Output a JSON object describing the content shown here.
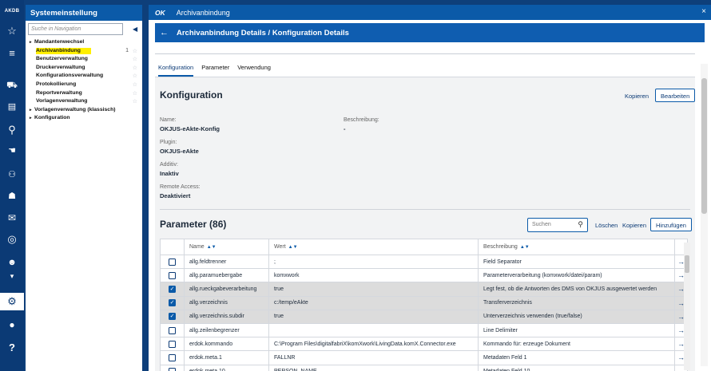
{
  "rail": {
    "logo": "AKDB",
    "icons": [
      "star-icon",
      "list-icon",
      "car-icon",
      "document-icon",
      "location-icon",
      "handshake-icon",
      "people-icon",
      "family-icon",
      "mail-icon",
      "target-icon",
      "user-gear-icon",
      "settings-icon",
      "user-icon",
      "help-icon"
    ]
  },
  "nav": {
    "title": "Systemeinstellung",
    "search_placeholder": "Suche in Navigation",
    "items": [
      {
        "label": "Mandantenwechsel",
        "arrow": "▸",
        "level": 0
      },
      {
        "label": "Archivanbindung",
        "level": 1,
        "highlight": true,
        "count": "1"
      },
      {
        "label": "Benutzerverwaltung",
        "level": 1
      },
      {
        "label": "Druckerverwaltung",
        "level": 1
      },
      {
        "label": "Konfigurationsverwaltung",
        "level": 1
      },
      {
        "label": "Protokollierung",
        "level": 1
      },
      {
        "label": "Reportverwaltung",
        "level": 1
      },
      {
        "label": "Vorlagenverwaltung",
        "level": 1
      },
      {
        "label": "Vorlagenverwaltung (klassisch)",
        "arrow": "▸",
        "level": 0
      },
      {
        "label": "Konfiguration",
        "arrow": "▸",
        "level": 0
      }
    ]
  },
  "window": {
    "brand": "OK",
    "title": "Archivanbindung",
    "close": "×"
  },
  "header": {
    "back": "←",
    "title": "Archivanbindung Details / Konfiguration Details"
  },
  "tabs": [
    "Konfiguration",
    "Parameter",
    "Verwendung"
  ],
  "config": {
    "title": "Konfiguration",
    "copy": "Kopieren",
    "edit": "Bearbeiten",
    "name_label": "Name:",
    "name_value": "OKJUS-eAkte-Konfig",
    "desc_label": "Beschreibung:",
    "desc_value": "-",
    "plugin_label": "Plugin:",
    "plugin_value": "OKJUS-eAkte",
    "active_label": "Additiv:",
    "active_value": "Inaktiv",
    "remote_label": "Remote Access:",
    "remote_value": "Deaktiviert"
  },
  "params": {
    "title": "Parameter (86)",
    "search_placeholder": "Suchen",
    "delete": "Löschen",
    "copy": "Kopieren",
    "add": "Hinzufügen",
    "columns": [
      "Name",
      "Wert",
      "Beschreibung"
    ],
    "rows": [
      {
        "name": "allg.feldtrenner",
        "value": ";",
        "desc": "Field Separator",
        "checked": false
      },
      {
        "name": "allg.paramuebergabe",
        "value": "komxwork",
        "desc": "Parameterverarbeitung (komxwork/datei/param)",
        "checked": false
      },
      {
        "name": "allg.rueckgabeverarbeitung",
        "value": "true",
        "desc": "Legt fest, ob die Antworten des DMS von OKJUS ausgewertet werden",
        "checked": true
      },
      {
        "name": "allg.verzeichnis",
        "value": "c:/temp/eAkte",
        "desc": "Transferverzeichnis",
        "checked": true
      },
      {
        "name": "allg.verzeichnis.subdir",
        "value": "true",
        "desc": "Unterverzeichnis verwenden (true/false)",
        "checked": true
      },
      {
        "name": "allg.zeilenbegrenzer",
        "value": "",
        "desc": "Line Delimiter",
        "checked": false
      },
      {
        "name": "erdok.kommando",
        "value": "C:\\Program Files\\digitalfabriX\\komXwork\\LivingData.komX.Connector.exe",
        "desc": "Kommando für: erzeuge Dokument",
        "checked": false
      },
      {
        "name": "erdok.meta.1",
        "value": "FALLNR",
        "desc": "Metadaten Feld 1",
        "checked": false
      },
      {
        "name": "erdok.meta.10",
        "value": "PERSON_NAME",
        "desc": "Metadaten Feld 10",
        "checked": false
      }
    ]
  }
}
